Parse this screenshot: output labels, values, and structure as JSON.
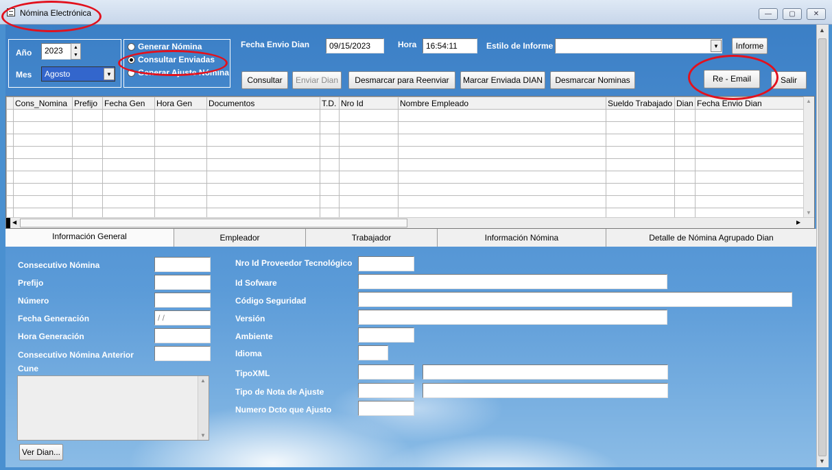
{
  "window": {
    "title": "Nómina Electrónica",
    "buttons": {
      "minimize": "—",
      "maximize": "▢",
      "close": "✕"
    }
  },
  "toolbar": {
    "year_label": "Año",
    "year_value": "2023",
    "month_label": "Mes",
    "month_value": "Agosto",
    "mode_options": [
      {
        "label": "Generar Nómina",
        "selected": false
      },
      {
        "label": "Consultar Enviadas",
        "selected": true
      },
      {
        "label": "Generar Ajuste Nómina",
        "selected": false
      }
    ],
    "fecha_envio_label": "Fecha Envio Dian",
    "fecha_envio_value": "09/15/2023",
    "hora_label": "Hora",
    "hora_value": "16:54:11",
    "estilo_label": "Estilo de Informe",
    "estilo_value": "",
    "informe_button": "Informe",
    "buttons": {
      "consultar": "Consultar",
      "enviar_dian": "Enviar Dian",
      "desmarcar_reenviar": "Desmarcar para Reenviar",
      "marcar_enviada": "Marcar Enviada DIAN",
      "desmarcar_nominas": "Desmarcar Nominas",
      "re_email": "Re - Email",
      "salir": "Salir"
    }
  },
  "grid": {
    "columns": [
      "Cons_Nomina",
      "Prefijo",
      "Fecha Gen",
      "Hora Gen",
      "Documentos",
      "T.D.",
      "Nro Id",
      "Nombre Empleado",
      "Sueldo Trabajado",
      "Dian",
      "Fecha Envio Dian"
    ],
    "row_count": 9
  },
  "tabs": [
    "Información General",
    "Empleador",
    "Trabajador",
    "Información Nómina",
    "Detalle de Nómina Agrupado Dian"
  ],
  "form": {
    "left": {
      "consecutivo_nomina": {
        "label": "Consecutivo Nómina",
        "value": ""
      },
      "prefijo": {
        "label": "Prefijo",
        "value": ""
      },
      "numero": {
        "label": "Número",
        "value": ""
      },
      "fecha_generacion": {
        "label": "Fecha Generación",
        "value": " / /"
      },
      "hora_generacion": {
        "label": "Hora Generación",
        "value": ""
      },
      "consecutivo_anterior": {
        "label": "Consecutivo Nómina Anterior",
        "value": ""
      },
      "cune": {
        "label": "Cune",
        "value": ""
      },
      "ver_dian_button": "Ver Dian..."
    },
    "right": {
      "nro_id_proveedor": {
        "label": "Nro Id Proveedor Tecnológico",
        "value": ""
      },
      "id_software": {
        "label": "Id Sofware",
        "value": ""
      },
      "codigo_seguridad": {
        "label": "Código Seguridad",
        "value": ""
      },
      "version": {
        "label": "Versión",
        "value": ""
      },
      "ambiente": {
        "label": "Ambiente",
        "value": ""
      },
      "idioma": {
        "label": "Idioma",
        "value": ""
      },
      "tipo_xml": {
        "label": "TipoXML",
        "value": "",
        "value2": ""
      },
      "tipo_nota_ajuste": {
        "label": "Tipo de Nota de Ajuste",
        "value": "",
        "value2": ""
      },
      "numero_dcto_ajusto": {
        "label": "Numero Dcto que Ajusto",
        "value": ""
      }
    }
  },
  "colors": {
    "annotation": "#e2111d",
    "background": "#4a90d0"
  }
}
